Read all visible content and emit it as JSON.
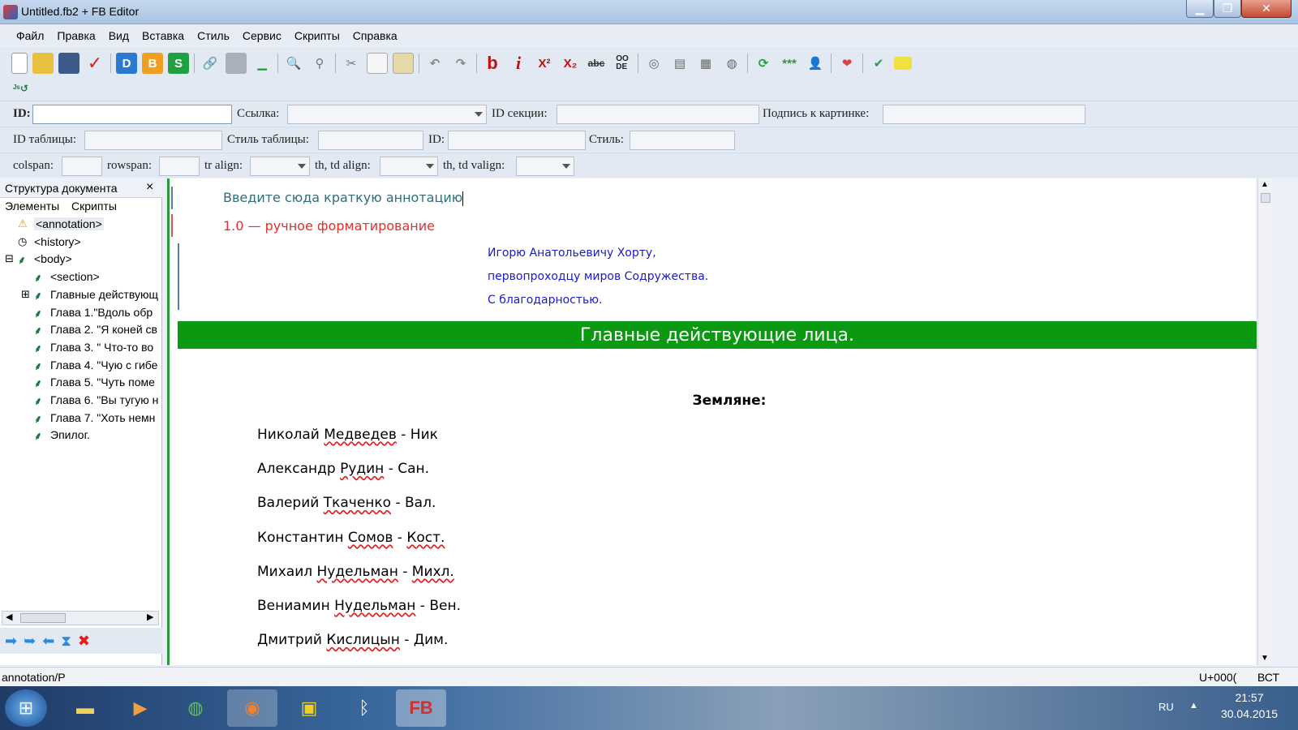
{
  "window": {
    "title": "Untitled.fb2 + FB Editor"
  },
  "menu": [
    "Файл",
    "Правка",
    "Вид",
    "Вставка",
    "Стиль",
    "Сервис",
    "Скрипты",
    "Справка"
  ],
  "toolbar": {
    "labels": [
      "D",
      "B",
      "S",
      "b",
      "i",
      "X²",
      "X₂",
      "abc",
      "OO\nDE",
      "***"
    ]
  },
  "fields": {
    "id_label": "ID:",
    "link_label": "Ссылка:",
    "section_id_label": "ID секции:",
    "caption_label": "Подпись к картинке:",
    "table_id_label": "ID таблицы:",
    "table_style_label": "Стиль таблицы:",
    "id2_label": "ID:",
    "style_label": "Стиль:",
    "colspan_label": "colspan:",
    "rowspan_label": "rowspan:",
    "tr_align_label": "tr align:",
    "thtd_align_label": "th, td align:",
    "thtd_valign_label": "th, td valign:"
  },
  "structure": {
    "title": "Структура документа",
    "close": "×",
    "tabs": [
      "Элементы",
      "Скрипты"
    ],
    "items": [
      {
        "label": "<annotation>",
        "icon": "warning-icon"
      },
      {
        "label": "<history>",
        "icon": "clock-icon"
      },
      {
        "label": "<body>",
        "icon": "leaf-icon",
        "expander": "⊟"
      },
      {
        "label": "<section>",
        "icon": "leaf-icon"
      },
      {
        "label": "Главные действующ",
        "icon": "leaf-icon",
        "expander": "⊞"
      },
      {
        "label": "Глава 1.\"Вдоль обр",
        "icon": "leaf-icon"
      },
      {
        "label": "Глава 2. \"Я коней св",
        "icon": "leaf-icon"
      },
      {
        "label": "Глава 3. \" Что-то во",
        "icon": "leaf-icon"
      },
      {
        "label": "Глава 4. \"Чую с гибе",
        "icon": "leaf-icon"
      },
      {
        "label": "Глава 5. \"Чуть поме",
        "icon": "leaf-icon"
      },
      {
        "label": "Глава 6. \"Вы тугую н",
        "icon": "leaf-icon"
      },
      {
        "label": "Глава 7. \"Хоть немн",
        "icon": "leaf-icon"
      },
      {
        "label": "Эпилог.",
        "icon": "leaf-icon"
      }
    ]
  },
  "editor": {
    "annotation": "Введите сюда краткую аннотацию",
    "version": "1.0 — ручное форматирование",
    "epigraph": [
      "Игорю Анатольевичу Хорту,",
      "первопроходцу миров Содружества.",
      "С благодарностью."
    ],
    "section_title": "Главные действующие лица.",
    "subtitle": "Земляне:",
    "cast": [
      {
        "first": "Николай ",
        "last": "Медведев",
        "sep": " - ",
        "nick": "Ник",
        "nick_err": false
      },
      {
        "first": "Александр ",
        "last": "Рудин",
        "sep": " - ",
        "nick": "Сан.",
        "nick_err": false
      },
      {
        "first": "Валерий ",
        "last": "Ткаченко",
        "sep": " - ",
        "nick": "Вал.",
        "nick_err": false
      },
      {
        "first": "Константин ",
        "last": "Сомов",
        "sep": " - ",
        "nick": "Кост.",
        "nick_err": true
      },
      {
        "first": "Михаил ",
        "last": "Нудельман",
        "sep": " - ",
        "nick": "Михл.",
        "nick_err": true
      },
      {
        "first": "Вениамин ",
        "last": "Нудельман",
        "sep": " - ",
        "nick": "Вен.",
        "nick_err": false
      },
      {
        "first": "Дмитрий ",
        "last": "Кислицын",
        "sep": " - ",
        "nick": "Дим.",
        "nick_err": false
      }
    ]
  },
  "status": {
    "path": "annotation/P",
    "code": "U+000(",
    "mode": "ВСТ"
  },
  "taskbar": {
    "lang": "RU",
    "time": "21:57",
    "date": "30.04.2015"
  }
}
